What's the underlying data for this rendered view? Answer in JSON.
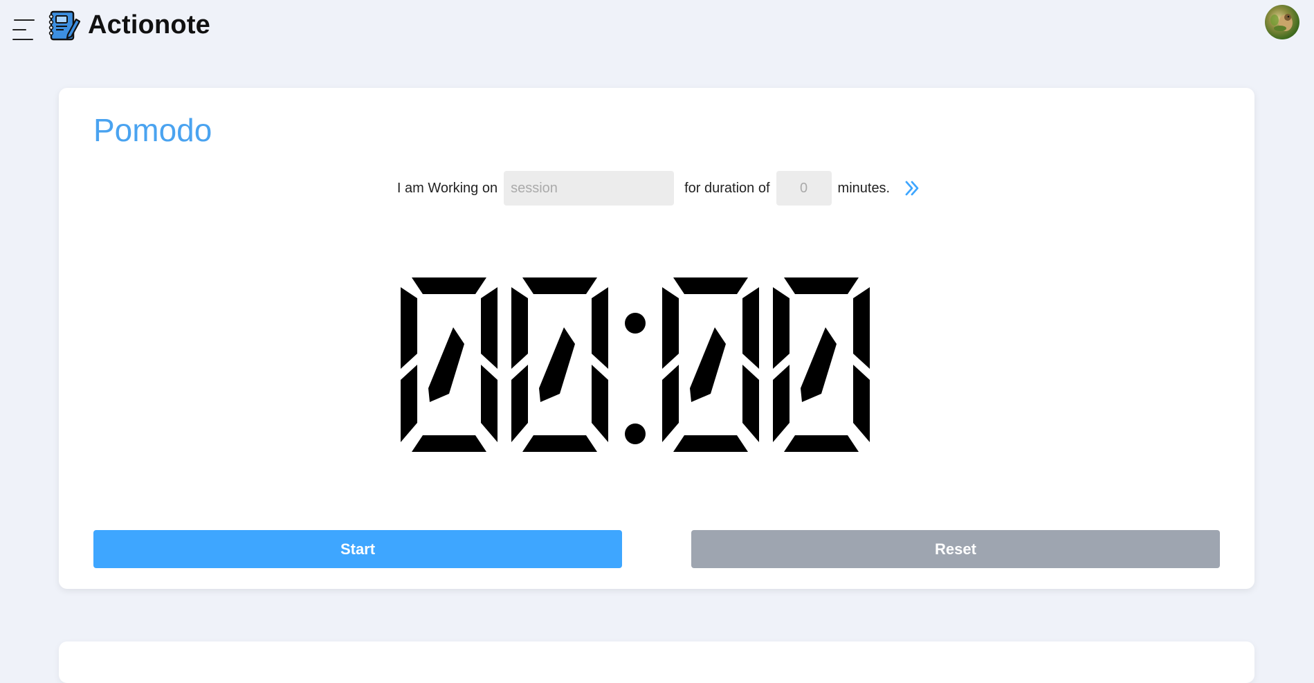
{
  "app": {
    "brand": "Actionote",
    "icons": {
      "menu": "menu-icon",
      "logo": "notebook-pen-icon",
      "go": "double-chevron-right-icon"
    },
    "accent_color": "#4aa3f0"
  },
  "pomodoro": {
    "title": "Pomodo",
    "task_prefix": "I am Working on",
    "session_placeholder": "session",
    "session_value": "",
    "duration_label": "for duration of",
    "duration_placeholder": "0",
    "duration_value": "",
    "minutes_label": "minutes.",
    "timer": {
      "minutes": "00",
      "seconds": "00"
    },
    "start_label": "Start",
    "reset_label": "Reset",
    "start_color": "#3ea6ff",
    "reset_color": "#9ea5b0"
  }
}
